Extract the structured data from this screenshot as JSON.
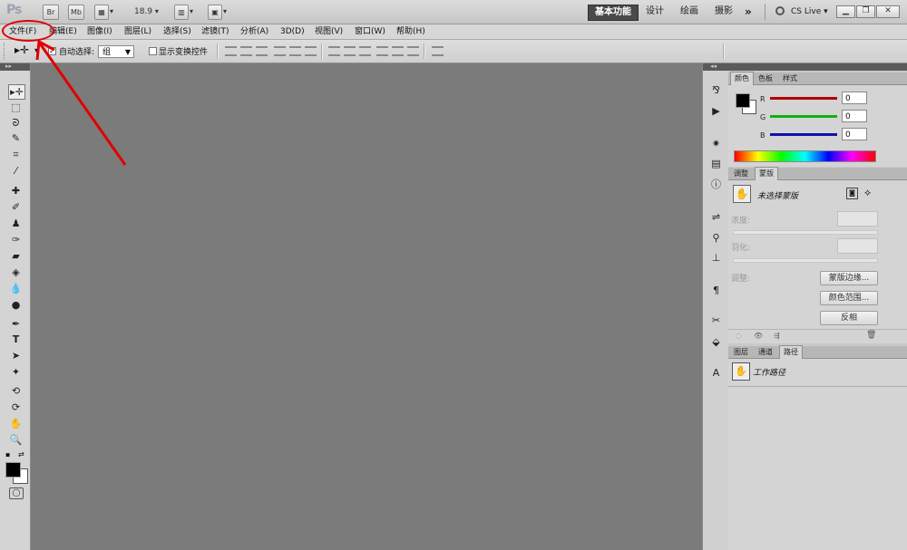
{
  "appbar": {
    "logo": "Ps",
    "br": "Br",
    "mb": "Mb",
    "zoom": "18.9",
    "workspaces": [
      "基本功能",
      "设计",
      "绘画",
      "摄影"
    ],
    "more": "»",
    "cslive": "CS Live"
  },
  "menubar": {
    "items": [
      "文件(F)",
      "编辑(E)",
      "图像(I)",
      "图层(L)",
      "选择(S)",
      "滤镜(T)",
      "分析(A)",
      "3D(D)",
      "视图(V)",
      "窗口(W)",
      "帮助(H)"
    ]
  },
  "options": {
    "auto_select_label": "自动选择:",
    "auto_select_value": "组",
    "show_transform_label": "显示变换控件"
  },
  "color_panel": {
    "tabs": [
      "颜色",
      "色板",
      "样式"
    ],
    "channels": [
      {
        "label": "R",
        "value": "0",
        "color": "#cc0000"
      },
      {
        "label": "G",
        "value": "0",
        "color": "#00aa00"
      },
      {
        "label": "B",
        "value": "0",
        "color": "#0000cc"
      }
    ]
  },
  "mask_panel": {
    "tabs": [
      "调整",
      "蒙版"
    ],
    "status": "未选择蒙版",
    "density_label": "浓度:",
    "feather_label": "羽化:",
    "refine_label": "调整:",
    "btn_edge": "蒙版边缘...",
    "btn_color_range": "颜色范围...",
    "btn_invert": "反相"
  },
  "paths_panel": {
    "tabs": [
      "图层",
      "通道",
      "路径"
    ],
    "items": [
      "工作路径"
    ]
  },
  "colors": {
    "annotation": "#e10000"
  }
}
